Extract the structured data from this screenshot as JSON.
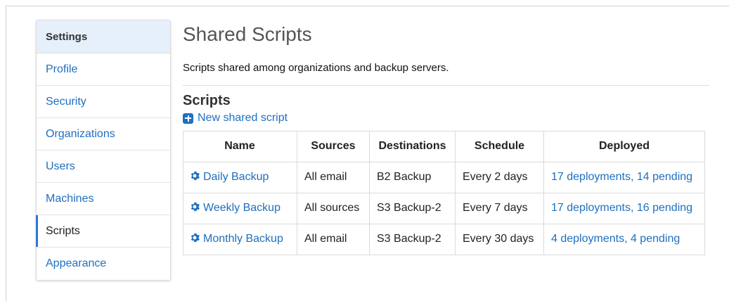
{
  "sidebar": {
    "header": "Settings",
    "items": [
      {
        "label": "Profile"
      },
      {
        "label": "Security"
      },
      {
        "label": "Organizations"
      },
      {
        "label": "Users"
      },
      {
        "label": "Machines"
      },
      {
        "label": "Scripts"
      },
      {
        "label": "Appearance"
      }
    ],
    "active": "Scripts"
  },
  "main": {
    "title": "Shared Scripts",
    "description": "Scripts shared among organizations and backup servers.",
    "section_title": "Scripts",
    "new_script_label": "New shared script",
    "table": {
      "headers": [
        "Name",
        "Sources",
        "Destinations",
        "Schedule",
        "Deployed"
      ],
      "rows": [
        {
          "name": "Daily Backup",
          "sources": "All email",
          "destinations": "B2 Backup",
          "schedule": "Every 2 days",
          "deployed": "17 deployments, 14 pending"
        },
        {
          "name": "Weekly Backup",
          "sources": "All sources",
          "destinations": "S3 Backup-2",
          "schedule": "Every 7 days",
          "deployed": "17 deployments, 16 pending"
        },
        {
          "name": "Monthly Backup",
          "sources": "All email",
          "destinations": "S3 Backup-2",
          "schedule": "Every 30 days",
          "deployed": "4 deployments, 4 pending"
        }
      ]
    }
  },
  "icons": {
    "row_icon": "gear-icon",
    "new_icon": "plus-square-icon"
  },
  "colors": {
    "link": "#1f6fbf",
    "active_indicator": "#2a7ad0",
    "sidebar_header_bg": "#e6f0fa"
  }
}
